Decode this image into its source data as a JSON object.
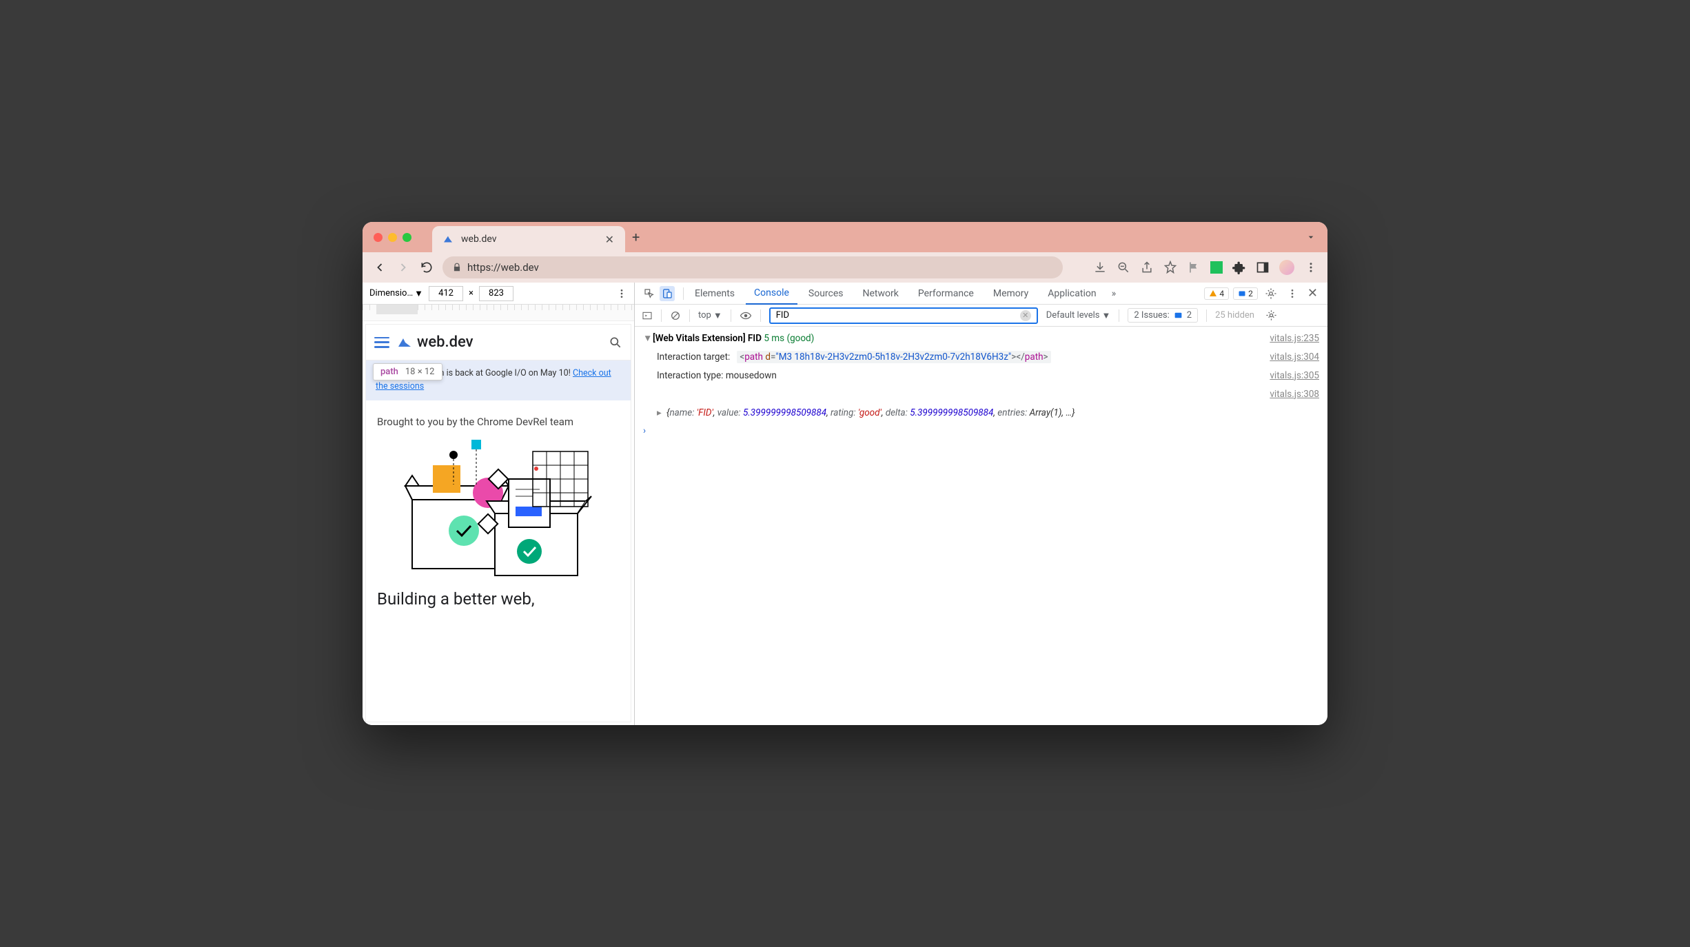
{
  "tab": {
    "title": "web.dev"
  },
  "address": {
    "url": "https://web.dev"
  },
  "device_toolbar": {
    "dimensions_label": "Dimensio…",
    "width": "412",
    "separator": "×",
    "height": "823"
  },
  "tooltip": {
    "tag": "path",
    "dims": "18 × 12"
  },
  "site": {
    "logo_text": "web.dev",
    "banner_text": "The Chrome team is back at Google I/O on May 10! ",
    "banner_link": "Check out the sessions",
    "brought": "Brought to you by the Chrome DevRel team",
    "heading": "Building a better web,"
  },
  "devtools": {
    "tabs": [
      "Elements",
      "Console",
      "Sources",
      "Network",
      "Performance",
      "Memory",
      "Application"
    ],
    "active_tab": "Console",
    "warn_count": "4",
    "info_count": "2",
    "console_bar": {
      "context": "top",
      "filter_value": "FID",
      "levels": "Default levels",
      "issues_label": "2 Issues:",
      "issues_count": "2",
      "hidden": "25 hidden"
    },
    "log": {
      "header_prefix": "[Web Vitals Extension] FID",
      "header_metric": "5 ms (good)",
      "target_label": "Interaction target:",
      "target_tag": "path",
      "target_attr": "d",
      "target_val": "\"M3 18h18v-2H3v2zm0-5h18v-2H3v2zm0-7v2h18V6H3z\"",
      "type_label": "Interaction type:",
      "type_val": "mousedown",
      "obj_text": "{name: 'FID', value: 5.399999998509884, rating: 'good', delta: 5.399999998509884, entries: Array(1), …}",
      "obj_name_k": "name:",
      "obj_name_v": "'FID'",
      "obj_value_k": "value:",
      "obj_value_v": "5.399999998509884",
      "obj_rating_k": "rating:",
      "obj_rating_v": "'good'",
      "obj_delta_k": "delta:",
      "obj_delta_v": "5.399999998509884",
      "obj_entries_k": "entries:",
      "obj_entries_v": "Array(1)",
      "sources": [
        "vitals.js:235",
        "vitals.js:304",
        "vitals.js:305",
        "vitals.js:308"
      ]
    }
  }
}
